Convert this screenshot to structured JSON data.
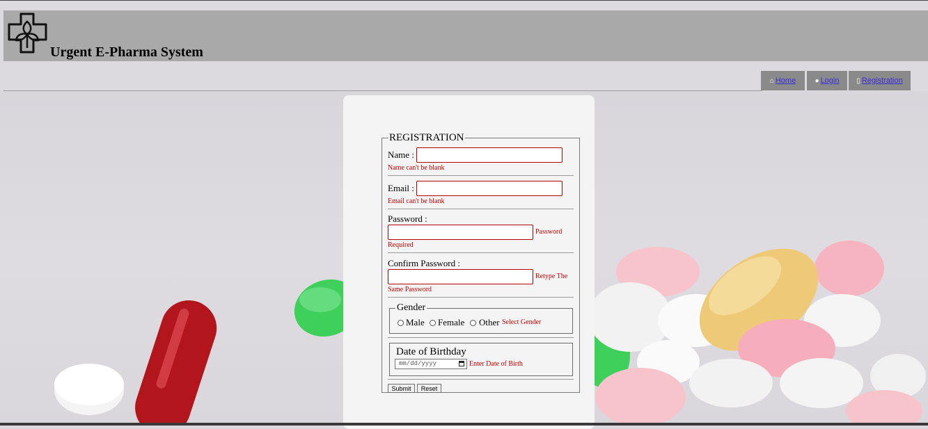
{
  "header": {
    "site_title": "Urgent E-Pharma System",
    "logo_icon": "pharmacy-cross-leaf-icon"
  },
  "nav": {
    "items": [
      {
        "label": "Home",
        "icon": "home-icon"
      },
      {
        "label": "Login",
        "icon": "user-icon"
      },
      {
        "label": "Registration",
        "icon": "mobile-icon"
      }
    ]
  },
  "form": {
    "legend": "REGISTRATION",
    "name_label": "Name :",
    "name_error": "Name can't be blank",
    "email_label": "Email :",
    "email_error": "Email can't be blank",
    "password_label": "Password :",
    "password_error_1": "Password",
    "password_error_2": "Required",
    "confirm_label": "Confirm Password :",
    "confirm_error_1": "Retype The",
    "confirm_error_2": "Same Password",
    "gender_legend": "Gender",
    "gender_options": [
      "Male",
      "Female",
      "Other"
    ],
    "gender_error": "Select Gender",
    "dob_legend": "Date of Birthday",
    "dob_placeholder": "mm/dd/yyyy",
    "dob_error": "Enter Date of Birth",
    "submit_label": "Submit",
    "reset_label": "Reset"
  },
  "colors": {
    "header_bg": "#a9a9a9",
    "nav_bg": "#8a8a8a",
    "error": "#c00000",
    "link": "#3b2bd6"
  }
}
